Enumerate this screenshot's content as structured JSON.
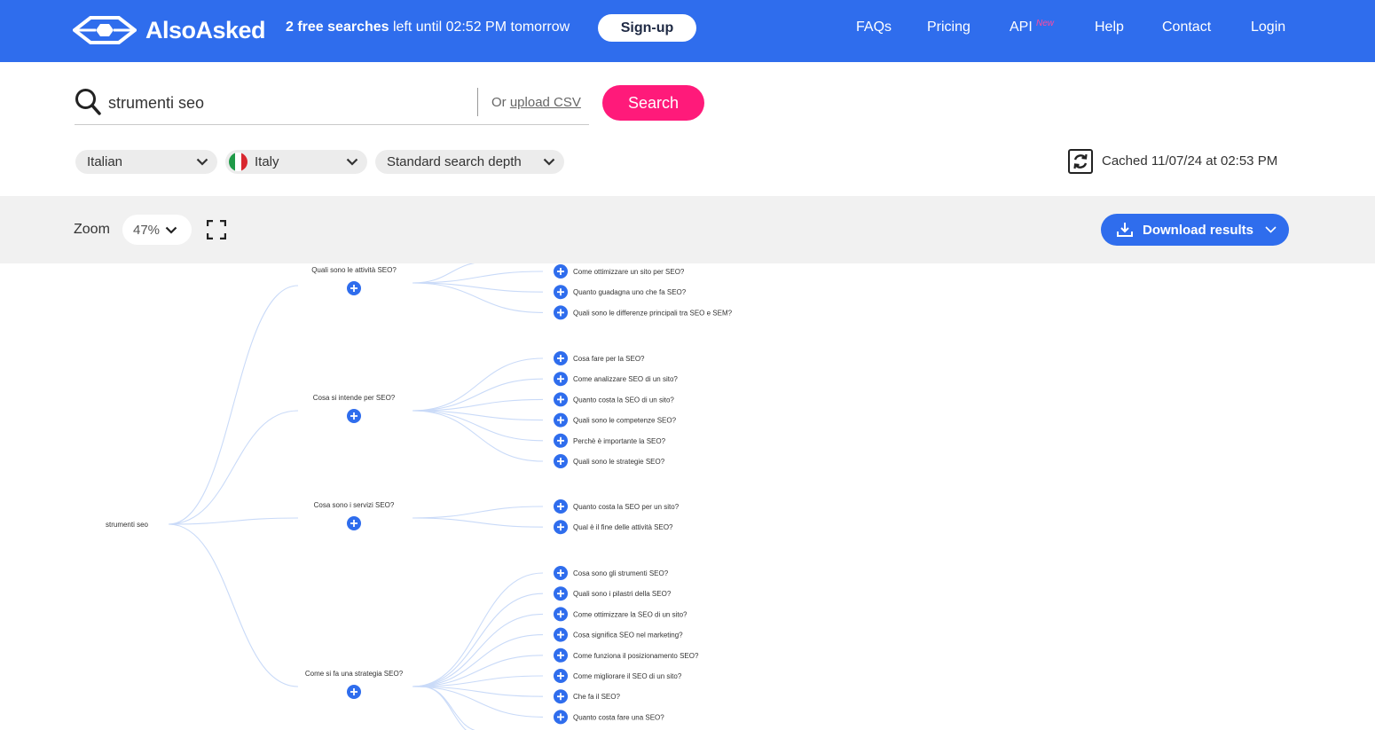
{
  "header": {
    "logo_text": "AlsoAsked",
    "quota_bold": "2 free searches",
    "quota_rest": " left until 02:52 PM tomorrow",
    "signup_label": "Sign-up",
    "nav": [
      "FAQs",
      "Pricing",
      "API",
      "Help",
      "Contact",
      "Login"
    ],
    "api_badge": "New"
  },
  "search": {
    "value": "strumenti seo",
    "upload_prefix": "Or ",
    "upload_link": "upload CSV",
    "button_label": "Search"
  },
  "filters": {
    "language": "Italian",
    "country": "Italy",
    "depth": "Standard search depth"
  },
  "cached": "Cached 11/07/24 at 02:53 PM",
  "toolbar": {
    "zoom_label": "Zoom",
    "zoom_value": "47%",
    "download_label": "Download results"
  },
  "tree": {
    "root": "strumenti seo",
    "branches": [
      {
        "question": "Quali sono le attività SEO?",
        "children": [
          "Come ottimizzare un sito per SEO?",
          "Quanto guadagna uno che fa SEO?",
          "Quali sono le differenze principali tra SEO e SEM?"
        ]
      },
      {
        "question": "Cosa si intende per SEO?",
        "children": [
          "Cosa fare per la SEO?",
          "Come analizzare SEO di un sito?",
          "Quanto costa la SEO di un sito?",
          "Quali sono le competenze SEO?",
          "Perchè è importante la SEO?",
          "Quali sono le strategie SEO?"
        ]
      },
      {
        "question": "Cosa sono i servizi SEO?",
        "children": [
          "Quanto costa la SEO per un sito?",
          "Qual è il fine delle attività SEO?"
        ]
      },
      {
        "question": "Come si fa una strategia SEO?",
        "children": [
          "Cosa sono gli strumenti SEO?",
          "Quali sono i pilastri della SEO?",
          "Come ottimizzare la SEO di un sito?",
          "Cosa significa SEO nel marketing?",
          "Come funziona il posizionamento SEO?",
          "Come migliorare il SEO di un sito?",
          "Che fa il SEO?",
          "Quanto costa fare una SEO?"
        ]
      }
    ]
  },
  "colors": {
    "brand_blue": "#2f6ded",
    "search_pink": "#ff1a7a",
    "link_line": "#c9daf8"
  }
}
